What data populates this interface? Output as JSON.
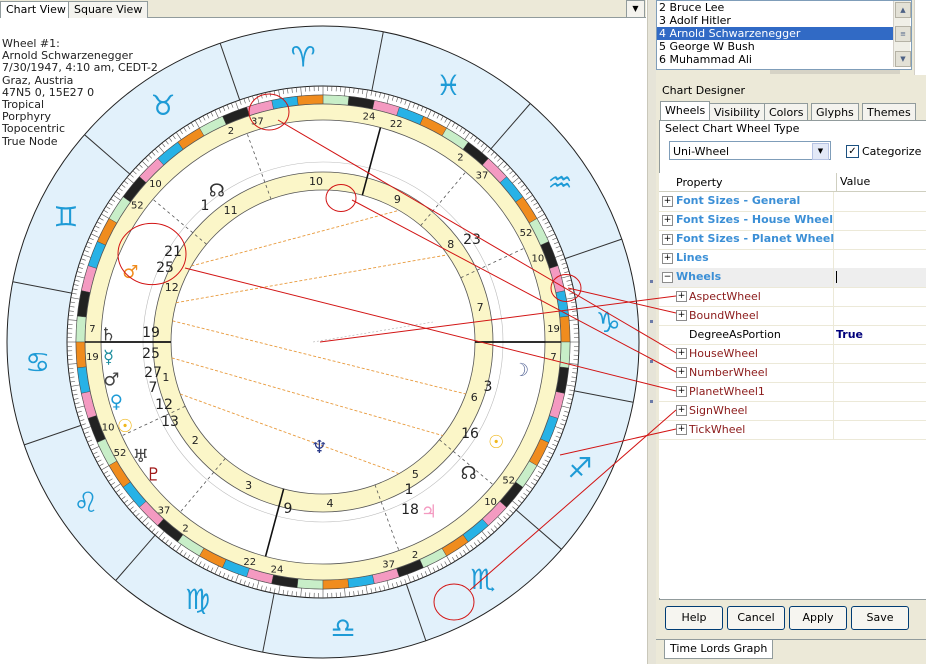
{
  "left_tabs": [
    "Chart View",
    "Square View"
  ],
  "chart_info": [
    "Wheel #1:",
    "Arnold Schwarzenegger",
    "7/30/1947, 4:10 am, CEDT-2",
    "Graz, Austria",
    "47N5 0, 15E27 0",
    "Tropical",
    "Porphyry",
    "Topocentric",
    "True Node"
  ],
  "wheel_list": [
    {
      "label": "2 Bruce Lee",
      "selected": false
    },
    {
      "label": "3 Adolf Hitler",
      "selected": false
    },
    {
      "label": "4 Arnold Schwarzenegger",
      "selected": true
    },
    {
      "label": "5 George W Bush",
      "selected": false
    },
    {
      "label": "6 Muhammad Ali",
      "selected": false
    }
  ],
  "designer": {
    "title": "Chart Designer",
    "tabs": [
      "Wheels",
      "Visibility",
      "Colors",
      "Glyphs",
      "Themes"
    ],
    "select_label": "Select Chart Wheel Type",
    "wheel_type": "Uni-Wheel",
    "categorize_label": "Categorize",
    "categorize_checked": true,
    "grid_headers": {
      "property": "Property",
      "value": "Value"
    },
    "categories": [
      "Font Sizes - General",
      "Font Sizes - House Wheel",
      "Font Sizes - Planet Wheel",
      "Lines",
      "Wheels"
    ],
    "wheel_items": [
      {
        "name": "AspectWheel",
        "value": "",
        "expandable": true
      },
      {
        "name": "BoundWheel",
        "value": "",
        "expandable": true
      },
      {
        "name": "DegreeAsPortion",
        "value": "True",
        "expandable": false
      },
      {
        "name": "HouseWheel",
        "value": "",
        "expandable": true
      },
      {
        "name": "NumberWheel",
        "value": "",
        "expandable": true
      },
      {
        "name": "PlanetWheel1",
        "value": "",
        "expandable": true
      },
      {
        "name": "SignWheel",
        "value": "",
        "expandable": true
      },
      {
        "name": "TickWheel",
        "value": "",
        "expandable": true
      }
    ],
    "buttons": [
      "Help",
      "Cancel",
      "Apply",
      "Save"
    ]
  },
  "bottom_tab": "Time Lords Graph",
  "wheel": {
    "house_numbers": [
      "12",
      "11",
      "10",
      "9",
      "8",
      "7",
      "6",
      "5",
      "4",
      "3",
      "2",
      "1"
    ],
    "cusp_labels": [
      {
        "deg": "19",
        "min": "7"
      },
      {
        "deg": "52",
        "min": "10"
      },
      {
        "deg": "2",
        "min": "37"
      },
      {
        "deg": "24",
        "min": "22"
      },
      {
        "deg": "2",
        "min": "37"
      },
      {
        "deg": "52",
        "min": "10"
      },
      {
        "deg": "19",
        "min": "7"
      },
      {
        "deg": "52",
        "min": "10"
      },
      {
        "deg": "2",
        "min": "37"
      },
      {
        "deg": "24",
        "min": "22"
      },
      {
        "deg": "2",
        "min": "37"
      },
      {
        "deg": "52",
        "min": "10"
      }
    ],
    "planet_degrees": [
      {
        "deg": "19",
        "min": "25"
      },
      {
        "deg": "27",
        "min": "7"
      },
      {
        "deg": "12",
        "min": "13"
      },
      {
        "deg": "21",
        "min": "25"
      },
      {
        "deg": "1",
        "min": ""
      },
      {
        "deg": "23",
        "min": ""
      },
      {
        "deg": "3",
        "min": ""
      },
      {
        "deg": "16",
        "min": ""
      },
      {
        "deg": "1",
        "min": "18"
      },
      {
        "deg": "9",
        "min": ""
      }
    ],
    "colors": {
      "sign_ring": "#e2f1fb",
      "zodiac_glyph": "#1e9bd6",
      "cream_ring": "#fbf6c8",
      "annotation": "#d21414",
      "aspect_line": "#e89a3c"
    }
  }
}
